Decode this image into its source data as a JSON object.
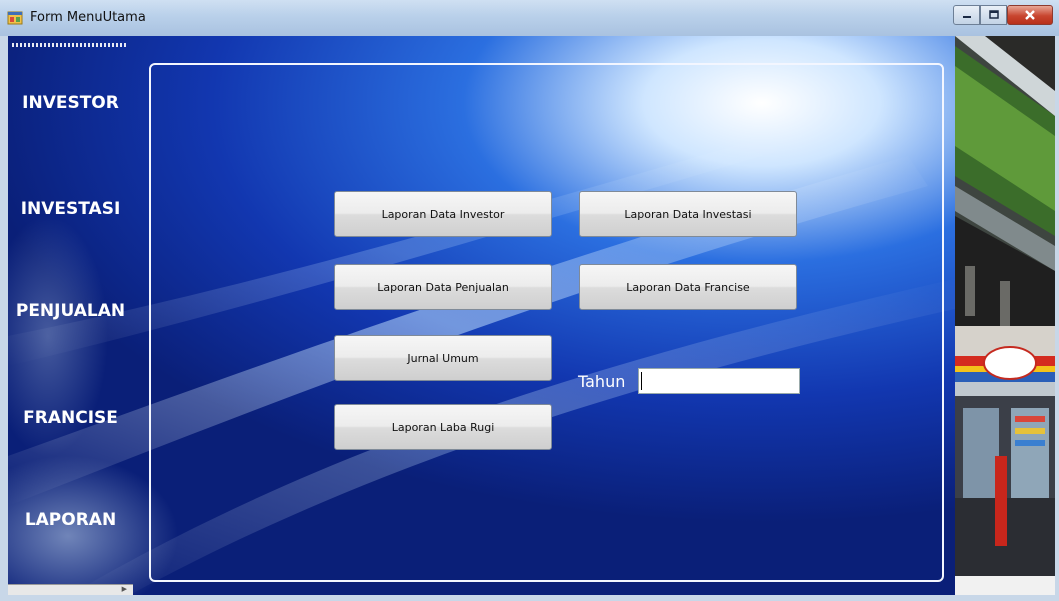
{
  "window": {
    "title": "Form MenuUtama"
  },
  "sidebar": {
    "items": [
      {
        "label": "INVESTOR"
      },
      {
        "label": "INVESTASI"
      },
      {
        "label": "PENJUALAN"
      },
      {
        "label": "FRANCISE"
      },
      {
        "label": "LAPORAN"
      }
    ]
  },
  "main": {
    "buttons": [
      {
        "label": "Laporan Data Investor"
      },
      {
        "label": "Laporan Data Investasi"
      },
      {
        "label": "Laporan Data Penjualan"
      },
      {
        "label": "Laporan Data Francise"
      },
      {
        "label": "Jurnal Umum"
      },
      {
        "label": "Laporan Laba Rugi"
      }
    ],
    "tahun": {
      "label": "Tahun",
      "value": ""
    }
  },
  "colors": {
    "background": "#0d2a8a",
    "titlebar": "#b9d0ea",
    "close_button": "#c8452f"
  },
  "icons": [
    "app-icon",
    "minimize-icon",
    "maximize-icon",
    "close-icon",
    "scroll-right-icon"
  ]
}
